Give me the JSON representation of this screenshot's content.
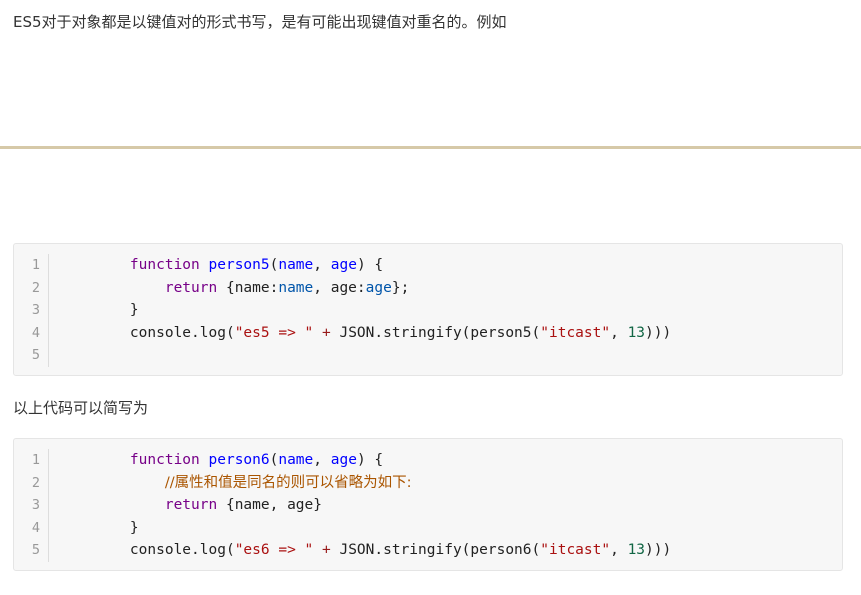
{
  "paragraphs": {
    "intro": "ES5对于对象都是以键值对的形式书写，是有可能出现键值对重名的。例如",
    "shorthand": "以上代码可以简写为"
  },
  "code_blocks": [
    {
      "line_numbers": [
        "1",
        "2",
        "3",
        "4",
        "5"
      ],
      "lines": [
        [
          {
            "t": "    ",
            "c": "pl"
          },
          {
            "t": "function",
            "c": "kw"
          },
          {
            "t": " ",
            "c": "pl"
          },
          {
            "t": "person5",
            "c": "fn"
          },
          {
            "t": "(",
            "c": "pl"
          },
          {
            "t": "name",
            "c": "fn"
          },
          {
            "t": ", ",
            "c": "pl"
          },
          {
            "t": "age",
            "c": "fn"
          },
          {
            "t": ") {",
            "c": "pl"
          }
        ],
        [
          {
            "t": "        ",
            "c": "pl"
          },
          {
            "t": "return",
            "c": "kw"
          },
          {
            "t": " {name:",
            "c": "pl"
          },
          {
            "t": "name",
            "c": "vr"
          },
          {
            "t": ", age:",
            "c": "pl"
          },
          {
            "t": "age",
            "c": "vr"
          },
          {
            "t": "};",
            "c": "pl"
          }
        ],
        [
          {
            "t": "    }",
            "c": "pl"
          }
        ],
        [
          {
            "t": "    console.log(",
            "c": "pl"
          },
          {
            "t": "\"es5 => \"",
            "c": "st"
          },
          {
            "t": " ",
            "c": "pl"
          },
          {
            "t": "+",
            "c": "op"
          },
          {
            "t": " JSON.stringify(person5(",
            "c": "pl"
          },
          {
            "t": "\"itcast\"",
            "c": "st"
          },
          {
            "t": ", ",
            "c": "pl"
          },
          {
            "t": "13",
            "c": "nm"
          },
          {
            "t": ")))",
            "c": "pl"
          }
        ],
        []
      ]
    },
    {
      "line_numbers": [
        "1",
        "2",
        "3",
        "4",
        "5"
      ],
      "lines": [
        [
          {
            "t": "    ",
            "c": "pl"
          },
          {
            "t": "function",
            "c": "kw"
          },
          {
            "t": " ",
            "c": "pl"
          },
          {
            "t": "person6",
            "c": "fn"
          },
          {
            "t": "(",
            "c": "pl"
          },
          {
            "t": "name",
            "c": "fn"
          },
          {
            "t": ", ",
            "c": "pl"
          },
          {
            "t": "age",
            "c": "fn"
          },
          {
            "t": ") {",
            "c": "pl"
          }
        ],
        [
          {
            "t": "        ",
            "c": "pl"
          },
          {
            "t": "//属性和值是同名的则可以省略为如下:",
            "c": "cm"
          }
        ],
        [
          {
            "t": "        ",
            "c": "pl"
          },
          {
            "t": "return",
            "c": "kw"
          },
          {
            "t": " {name, age}",
            "c": "pl"
          }
        ],
        [
          {
            "t": "    }",
            "c": "pl"
          }
        ],
        [
          {
            "t": "    console.log(",
            "c": "pl"
          },
          {
            "t": "\"es6 => \"",
            "c": "st"
          },
          {
            "t": " ",
            "c": "pl"
          },
          {
            "t": "+",
            "c": "op"
          },
          {
            "t": " JSON.stringify(person6(",
            "c": "pl"
          },
          {
            "t": "\"itcast\"",
            "c": "st"
          },
          {
            "t": ", ",
            "c": "pl"
          },
          {
            "t": "13",
            "c": "nm"
          },
          {
            "t": ")))",
            "c": "pl"
          }
        ]
      ]
    }
  ]
}
